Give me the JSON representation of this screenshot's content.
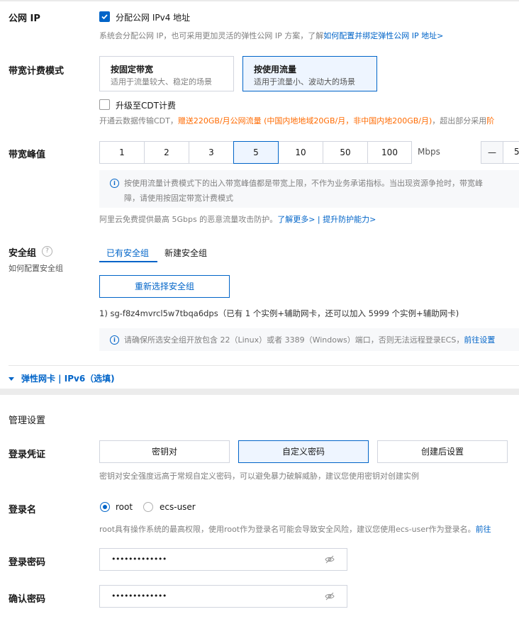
{
  "public_ip": {
    "label": "公网 IP",
    "checkbox_label": "分配公网 IPv4 地址",
    "hint_prefix": "系统会分配公网 IP，也可采用更加灵活的弹性公网 IP 方案，了解",
    "hint_link": "如何配置并绑定弹性公网 IP 地址>"
  },
  "billing": {
    "label": "带宽计费模式",
    "options": [
      {
        "title": "按固定带宽",
        "desc": "适用于流量较大、稳定的场景"
      },
      {
        "title": "按使用流量",
        "desc": "适用于流量小、波动大的场景"
      }
    ],
    "cdt_label": "升级至CDT计费",
    "cdt_hint_prefix": "开通云数据传输CDT，",
    "cdt_hint_highlight": "赠送220GB/月公网流量 (中国内地地域20GB/月，非中国内地200GB/月)",
    "cdt_hint_suffix": "，超出部分采用",
    "cdt_hint_tail": "阶"
  },
  "bandwidth": {
    "label": "带宽峰值",
    "values": [
      "1",
      "2",
      "3",
      "5",
      "10",
      "50",
      "100"
    ],
    "unit": "Mbps",
    "stepper_minus": "—",
    "stepper_value": "5",
    "notice_line1": "按使用流量计费模式下的出入带宽峰值都是带宽上限，不作为业务承诺指标。当出现资源争抢时，带宽峰",
    "notice_line2": "障，请使用按固定带宽计费模式",
    "ddos_hint": "阿里云免费提供最高 5Gbps 的恶意流量攻击防护。",
    "ddos_link1": "了解更多>",
    "ddos_sep": " | ",
    "ddos_link2": "提升防护能力>"
  },
  "security_group": {
    "label": "安全组",
    "sub_label": "如何配置安全组",
    "tabs": [
      "已有安全组",
      "新建安全组"
    ],
    "reselect_button": "重新选择安全组",
    "selected": "1) sg-f8z4mvrcl5w7tbqa6dps（已有 1 个实例+辅助网卡，还可以加入 5999 个实例+辅助网卡)",
    "notice": "请确保所选安全组开放包含 22（Linux）或者 3389（Windows）端口，否则无法远程登录ECS，",
    "notice_link": "前往设置"
  },
  "eni": {
    "toggle": "弹性网卡 | IPv6（选填)"
  },
  "management": {
    "section_title": "管理设置",
    "credential_label": "登录凭证",
    "credential_options": [
      "密钥对",
      "自定义密码",
      "创建后设置"
    ],
    "credential_hint": "密钥对安全强度远高于常规自定义密码，可以避免暴力破解威胁，建议您使用密钥对创建实例",
    "login_name_label": "登录名",
    "login_name_options": [
      "root",
      "ecs-user"
    ],
    "login_name_hint": "root具有操作系统的最高权限，使用root作为登录名可能会导致安全风险，建议您使用ecs-user作为登录名。",
    "login_name_link": "前往",
    "password_label": "登录密码",
    "password_value": "•••••••••••••",
    "confirm_label": "确认密码",
    "confirm_value": "•••••••••••••"
  },
  "colors": {
    "accent": "#0064c8",
    "highlight": "#ff6a00",
    "selected_bg": "#eef5ff",
    "border": "#d1d5de",
    "notice_bg": "#f7f8fa"
  }
}
